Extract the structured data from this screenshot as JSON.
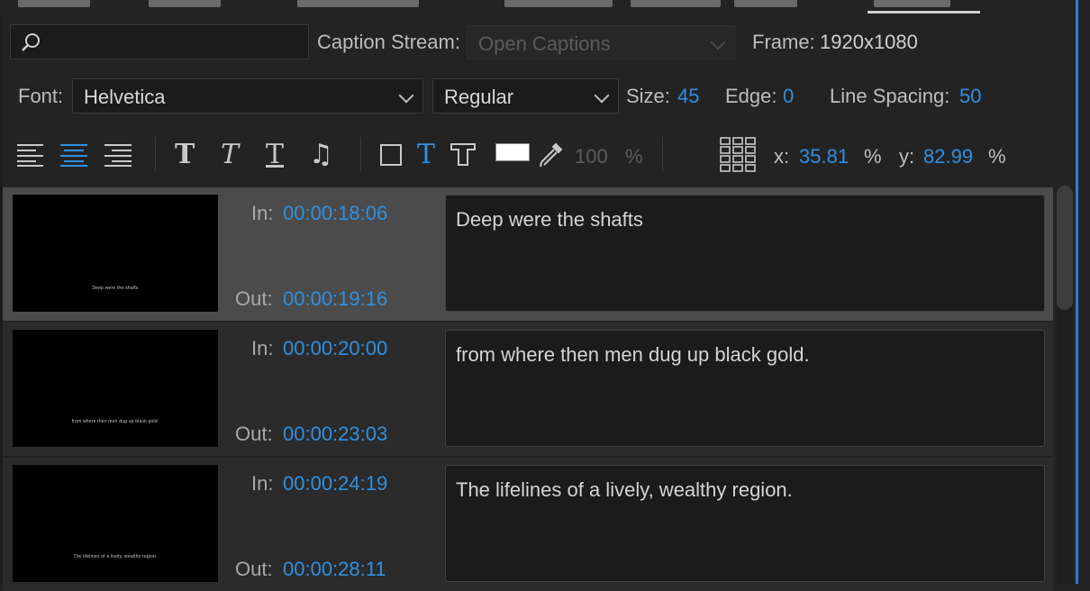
{
  "search": {
    "placeholder": "",
    "value": ""
  },
  "caption_stream": {
    "label": "Caption Stream:",
    "value": "Open Captions"
  },
  "frame": {
    "label": "Frame:",
    "value": "1920x1080"
  },
  "font": {
    "label": "Font:",
    "family": "Helvetica",
    "style": "Regular"
  },
  "size": {
    "label": "Size:",
    "value": "45"
  },
  "edge": {
    "label": "Edge:",
    "value": "0"
  },
  "line_spacing": {
    "label": "Line Spacing:",
    "value": "50"
  },
  "toolbar": {
    "opacity_value": "100",
    "opacity_unit": "%",
    "x_label": "x:",
    "x_value": "35.81",
    "x_unit": "%",
    "y_label": "y:",
    "y_value": "82.99",
    "y_unit": "%"
  },
  "colors": {
    "accent": "#2f8fe0",
    "selected_row": "#4b4b4b",
    "panel": "#232323"
  },
  "captions": [
    {
      "in_label": "In:",
      "in": "00:00:18:06",
      "out_label": "Out:",
      "out": "00:00:19:16",
      "text": "Deep were the shafts",
      "selected": true
    },
    {
      "in_label": "In:",
      "in": "00:00:20:00",
      "out_label": "Out:",
      "out": "00:00:23:03",
      "text": "from where then men dug up black gold.",
      "selected": false
    },
    {
      "in_label": "In:",
      "in": "00:00:24:19",
      "out_label": "Out:",
      "out": "00:00:28:11",
      "text": "The lifelines of a lively, wealthy region.",
      "selected": false
    }
  ]
}
